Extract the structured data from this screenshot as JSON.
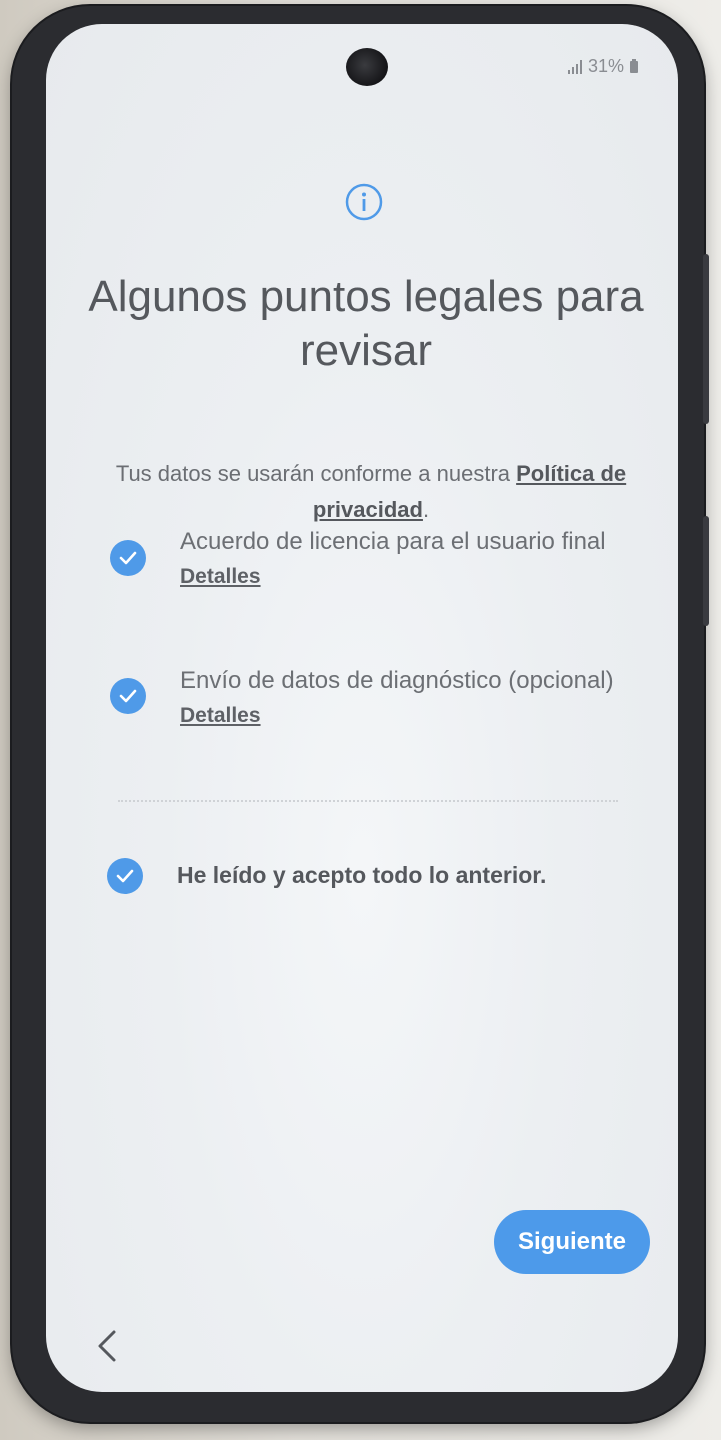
{
  "status_bar": {
    "battery": "31%"
  },
  "header": {
    "title": "Algunos puntos legales para revisar"
  },
  "intro": {
    "text_before_link": "Tus datos se usarán conforme a nuestra ",
    "link_text": "Política de privacidad",
    "text_after_link": "."
  },
  "agreements": [
    {
      "label": "Acuerdo de licencia para el usuario final",
      "details_label": "Detalles",
      "checked": true
    },
    {
      "label": "Envío de datos de diagnóstico (opcional)",
      "details_label": "Detalles",
      "checked": true
    }
  ],
  "accept_all": {
    "label": "He leído y acepto todo lo anterior.",
    "checked": true
  },
  "footer": {
    "next_label": "Siguiente"
  },
  "colors": {
    "accent": "#4d9aea",
    "text": "#55585d"
  },
  "icons": {
    "info": "info-icon",
    "check": "check-icon",
    "back": "back-icon"
  }
}
